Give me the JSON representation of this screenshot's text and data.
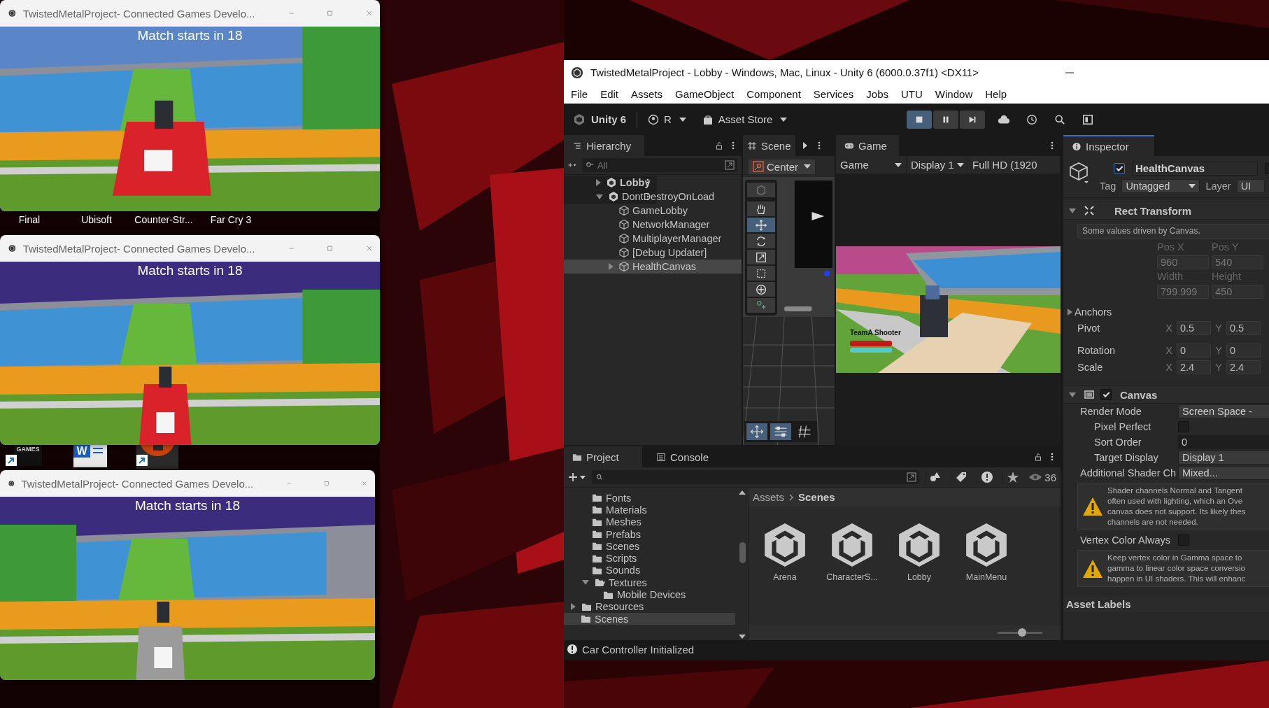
{
  "desktop": {
    "icon_labels": [
      "Final",
      "Ubisoft",
      "Counter-Str...",
      "Far Cry 3"
    ],
    "shortcuts": [
      {
        "kind": "epic",
        "text": "GAMES",
        "link": true
      },
      {
        "kind": "word",
        "text": "W",
        "link": false
      },
      {
        "kind": "app",
        "link": true
      }
    ]
  },
  "game_windows": [
    {
      "title": "TwistedMetalProject- Connected Games Develo...",
      "overlay": "Match starts in 18"
    },
    {
      "title": "TwistedMetalProject- Connected Games Develo...",
      "overlay": "Match starts in 18"
    },
    {
      "title": "TwistedMetalProject- Connected Games Develo...",
      "overlay": "Match starts in 18"
    }
  ],
  "unity": {
    "title": "TwistedMetalProject - Lobby - Windows, Mac, Linux - Unity 6 (6000.0.37f1) <DX11>",
    "menu": [
      "File",
      "Edit",
      "Assets",
      "GameObject",
      "Component",
      "Services",
      "Jobs",
      "UTU",
      "Window",
      "Help"
    ],
    "toolbar": {
      "product": "Unity 6",
      "account": "R",
      "store": "Asset Store",
      "play_controls": [
        {
          "kind": "stop",
          "selected": true
        },
        {
          "kind": "pause",
          "selected": false
        },
        {
          "kind": "step",
          "selected": false
        }
      ]
    },
    "hierarchy": {
      "tab": "Hierarchy",
      "placeholder": "All",
      "tree": [
        {
          "name": "Lobby",
          "kind": "scene",
          "expanded": false,
          "selected": false
        },
        {
          "name": "DontDestroyOnLoad",
          "kind": "scene",
          "expanded": true,
          "selected": false,
          "children": [
            {
              "name": "GameLobby",
              "kind": "object",
              "selected": false
            },
            {
              "name": "NetworkManager",
              "kind": "object",
              "selected": false
            },
            {
              "name": "MultiplayerManager",
              "kind": "object",
              "selected": false
            },
            {
              "name": "[Debug Updater]",
              "kind": "object",
              "selected": false
            },
            {
              "name": "HealthCanvas",
              "kind": "object",
              "expanded": false,
              "selected": true
            }
          ]
        }
      ]
    },
    "scene": {
      "tab": "Scene",
      "pivot": "Center",
      "tools": [
        {
          "kind": "view",
          "selected": false
        },
        {
          "kind": "hand",
          "selected": false
        },
        {
          "kind": "move",
          "selected": true
        },
        {
          "kind": "rotate",
          "selected": false
        },
        {
          "kind": "scale",
          "selected": false
        },
        {
          "kind": "rect",
          "selected": false
        },
        {
          "kind": "transform",
          "selected": false
        },
        {
          "kind": "custom",
          "selected": false
        }
      ]
    },
    "game": {
      "tab": "Game",
      "dropdowns": [
        "Game",
        "Display 1",
        "Full HD (1920"
      ],
      "hud_label": "TeamA Shooter"
    },
    "inspector": {
      "tab": "Inspector",
      "object": {
        "active": true,
        "name": "HealthCanvas",
        "static": false,
        "tag_label": "Tag",
        "tag": "Untagged",
        "layer_label": "Layer",
        "layer": "UI"
      },
      "rect_transform": {
        "title": "Rect Transform",
        "expanded": true,
        "note": "Some values driven by Canvas.",
        "fields": [
          {
            "label": "Pos X",
            "value": "960"
          },
          {
            "label": "Pos Y",
            "value": "540"
          },
          {
            "label": "Width",
            "value": "799.999"
          },
          {
            "label": "Height",
            "value": "450"
          }
        ],
        "anchors": {
          "label": "Anchors",
          "expanded": false
        },
        "rows": [
          {
            "label": "Pivot",
            "values": [
              {
                "axis": "X",
                "value": "0.5"
              },
              {
                "axis": "Y",
                "value": "0.5"
              }
            ]
          },
          {
            "label": "Rotation",
            "values": [
              {
                "axis": "X",
                "value": "0"
              },
              {
                "axis": "Y",
                "value": "0"
              }
            ]
          },
          {
            "label": "Scale",
            "values": [
              {
                "axis": "X",
                "value": "2.4"
              },
              {
                "axis": "Y",
                "value": "2.4"
              }
            ]
          }
        ]
      },
      "canvas": {
        "title": "Canvas",
        "expanded": true,
        "enabled": true,
        "properties": [
          {
            "kind": "dropdown",
            "label": "Render Mode",
            "value": "Screen Space -",
            "children": [
              {
                "kind": "checkbox",
                "label": "Pixel Perfect",
                "checked": false
              },
              {
                "kind": "field",
                "label": "Sort Order",
                "value": "0"
              },
              {
                "kind": "dropdown",
                "label": "Target Display",
                "value": "Display 1"
              }
            ]
          },
          {
            "kind": "dropdown",
            "label": "Additional Shader Ch",
            "value": "Mixed..."
          },
          {
            "kind": "warning",
            "lines": [
              "Shader channels Normal and Tangent",
              "often used with lighting, which an Ove",
              "canvas does not support. Its likely thes",
              "channels are not needed."
            ]
          },
          {
            "kind": "checkbox",
            "label": "Vertex Color Always",
            "checked": false
          },
          {
            "kind": "warning",
            "lines": [
              "Keep vertex color in Gamma space to",
              "gamma to linear color space conversio",
              "happen in UI shaders. This will enhanc"
            ]
          }
        ]
      },
      "asset_labels": "Asset Labels"
    },
    "project": {
      "tabs": [
        {
          "label": "Project",
          "selected": true
        },
        {
          "label": "Console",
          "selected": false
        }
      ],
      "hidden_count": "36",
      "tree": [
        {
          "children": [
            {
              "name": "Fonts",
              "selected": false
            },
            {
              "name": "Materials",
              "selected": false
            },
            {
              "name": "Meshes",
              "selected": false
            },
            {
              "name": "Prefabs",
              "selected": false
            },
            {
              "name": "Scenes",
              "selected": false
            },
            {
              "name": "Scripts",
              "selected": false
            },
            {
              "name": "Sounds",
              "selected": false
            },
            {
              "name": "Textures",
              "expanded": true,
              "selected": false,
              "children": [
                {
                  "name": "Mobile Devices",
                  "selected": false
                }
              ]
            }
          ]
        },
        {
          "name": "Resources",
          "expanded": false,
          "selected": false
        },
        {
          "name": "Scenes",
          "selected": true
        }
      ],
      "breadcrumb": [
        "Assets",
        "Scenes"
      ],
      "assets": [
        "Arena",
        "CharacterS...",
        "Lobby",
        "MainMenu"
      ],
      "zoom": {
        "level": 0.55
      }
    },
    "status": "Car Controller Initialized"
  }
}
